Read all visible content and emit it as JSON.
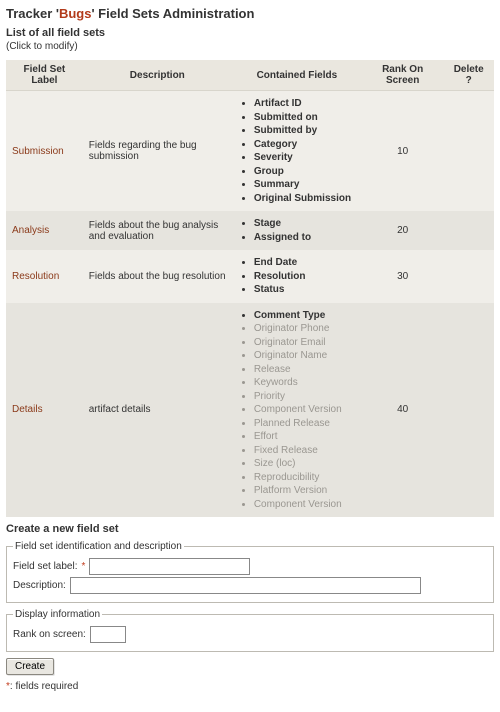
{
  "title_prefix": "Tracker '",
  "title_accent": "Bugs",
  "title_suffix": "' Field Sets Administration",
  "list_heading": "List of all field sets",
  "click_hint": "(Click to modify)",
  "columns": {
    "label": "Field Set Label",
    "desc": "Description",
    "contained": "Contained Fields",
    "rank": "Rank On Screen",
    "del": "Delete ?"
  },
  "rows": [
    {
      "label": "Submission",
      "desc": "Fields regarding the bug submission",
      "rank": "10",
      "fields": [
        {
          "t": "Artifact ID",
          "b": true
        },
        {
          "t": "Submitted on",
          "b": true
        },
        {
          "t": "Submitted by",
          "b": true
        },
        {
          "t": "Category",
          "b": true
        },
        {
          "t": "Severity",
          "b": true
        },
        {
          "t": "Group",
          "b": true
        },
        {
          "t": "Summary",
          "b": true
        },
        {
          "t": "Original Submission",
          "b": true
        }
      ]
    },
    {
      "label": "Analysis",
      "desc": "Fields about the bug analysis and evaluation",
      "rank": "20",
      "fields": [
        {
          "t": "Stage",
          "b": true
        },
        {
          "t": "Assigned to",
          "b": true
        }
      ]
    },
    {
      "label": "Resolution",
      "desc": "Fields about the bug resolution",
      "rank": "30",
      "fields": [
        {
          "t": "End Date",
          "b": true
        },
        {
          "t": "Resolution",
          "b": true
        },
        {
          "t": "Status",
          "b": true
        }
      ]
    },
    {
      "label": "Details",
      "desc": "artifact details",
      "rank": "40",
      "fields": [
        {
          "t": "Comment Type",
          "b": true
        },
        {
          "t": "Originator Phone",
          "m": true
        },
        {
          "t": "Originator Email",
          "m": true
        },
        {
          "t": "Originator Name",
          "m": true
        },
        {
          "t": "Release",
          "m": true
        },
        {
          "t": "Keywords",
          "m": true
        },
        {
          "t": "Priority",
          "m": true
        },
        {
          "t": "Component Version",
          "m": true
        },
        {
          "t": "Planned Release",
          "m": true
        },
        {
          "t": "Effort",
          "m": true
        },
        {
          "t": "Fixed Release",
          "m": true
        },
        {
          "t": "Size (loc)",
          "m": true
        },
        {
          "t": "Reproducibility",
          "m": true
        },
        {
          "t": "Platform Version",
          "m": true
        },
        {
          "t": "Component Version",
          "m": true
        }
      ]
    }
  ],
  "create_heading": "Create a new field set",
  "fieldset_id_legend": "Field set identification and description",
  "label_fieldset_label": "Field set label:",
  "label_description": "Description:",
  "display_legend": "Display information",
  "label_rank": "Rank on screen:",
  "value_fieldset_label": "",
  "value_description": "",
  "value_rank": "",
  "btn_create": "Create",
  "req_marker": "*",
  "req_note_prefix": "*",
  "req_note_text": ": fields required"
}
